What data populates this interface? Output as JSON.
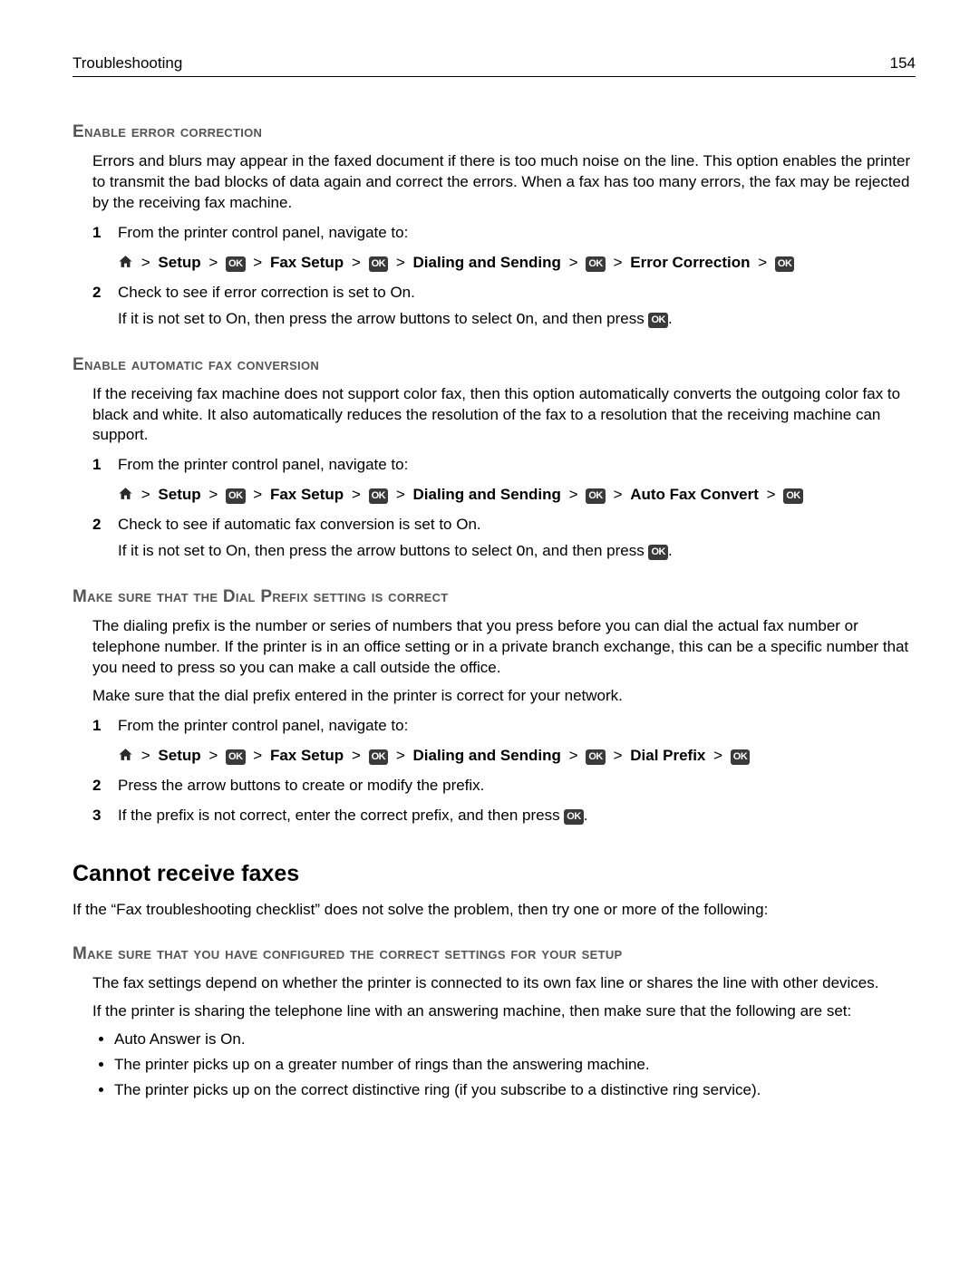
{
  "header": {
    "title": "Troubleshooting",
    "page_num": "154"
  },
  "nav_common": {
    "setup": "Setup",
    "fax_setup": "Fax Setup",
    "dialing_sending": "Dialing and Sending",
    "ok": "OK"
  },
  "sec1": {
    "heading": "Enable error correction",
    "intro": "Errors and blurs may appear in the faxed document if there is too much noise on the line. This option enables the printer to transmit the bad blocks of data again and correct the errors. When a fax has too many errors, the fax may be rejected by the receiving fax machine.",
    "step1": "From the printer control panel, navigate to:",
    "path_last": "Error Correction",
    "step2": "Check to see if error correction is set to On.",
    "step2_sub_a": "If it is not set to On, then press the arrow buttons to select ",
    "on_literal": "On",
    "step2_sub_b": ", and then press "
  },
  "sec2": {
    "heading": "Enable automatic fax conversion",
    "intro": "If the receiving fax machine does not support color fax, then this option automatically converts the outgoing color fax to black and white. It also automatically reduces the resolution of the fax to a resolution that the receiving machine can support.",
    "step1": "From the printer control panel, navigate to:",
    "path_last": "Auto Fax Convert",
    "step2": "Check to see if automatic fax conversion is set to On.",
    "step2_sub_a": "If it is not set to On, then press the arrow buttons to select ",
    "on_literal": "On",
    "step2_sub_b": ", and then press "
  },
  "sec3": {
    "heading": "Make sure that the Dial Prefix setting is correct",
    "p1": "The dialing prefix is the number or series of numbers that you press before you can dial the actual fax number or telephone number. If the printer is in an office setting or in a private branch exchange, this can be a specific number that you need to press so you can make a call outside the office.",
    "p2": "Make sure that the dial prefix entered in the printer is correct for your network.",
    "step1": "From the printer control panel, navigate to:",
    "path_last": "Dial Prefix",
    "step2": "Press the arrow buttons to create or modify the prefix.",
    "step3": "If the prefix is not correct, enter the correct prefix, and then press "
  },
  "sec4": {
    "h2": "Cannot receive faxes",
    "intro": "If the “Fax troubleshooting checklist” does not solve the problem, then try one or more of the following:",
    "h3": "Make sure that you have configured the correct settings for your setup",
    "p1": "The fax settings depend on whether the printer is connected to its own fax line or shares the line with other devices.",
    "p2": "If the printer is sharing the telephone line with an answering machine, then make sure that the following are set:",
    "bullets": [
      "Auto Answer is On.",
      "The printer picks up on a greater number of rings than the answering machine.",
      "The printer picks up on the correct distinctive ring (if you subscribe to a distinctive ring service)."
    ]
  }
}
